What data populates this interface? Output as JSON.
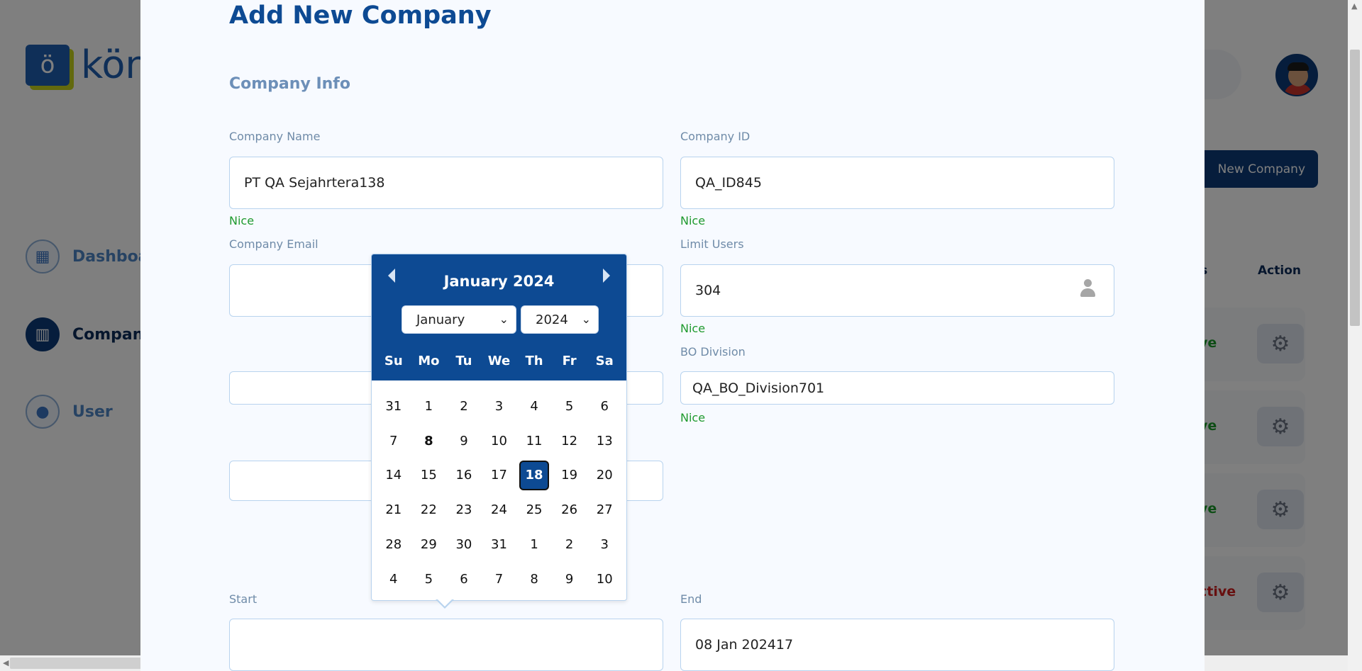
{
  "background": {
    "logo": {
      "mark": "ö",
      "text": "kön"
    },
    "sidebar": [
      {
        "label": "Dashboa",
        "icon": "dashboard-icon"
      },
      {
        "label": "Company",
        "icon": "company-icon"
      },
      {
        "label": "User",
        "icon": "user-icon"
      }
    ],
    "new_company_button": "New Company",
    "table": {
      "columns": [
        "us",
        "Action"
      ],
      "rows": [
        {
          "status": "ve",
          "status_color": "#1a9a2b"
        },
        {
          "status": "ve",
          "status_color": "#1a9a2b"
        },
        {
          "status": "ve",
          "status_color": "#1a9a2b"
        },
        {
          "status": "ctive",
          "status_color": "#cf1e1e"
        }
      ]
    }
  },
  "modal": {
    "title": "Add New Company",
    "section_title": "Company Info",
    "fields": {
      "company_name": {
        "label": "Company Name",
        "value": "PT QA Sejahrtera138",
        "hint": "Nice"
      },
      "company_id": {
        "label": "Company ID",
        "value": "QA_ID845",
        "hint": "Nice"
      },
      "company_email": {
        "label": "Company Email",
        "value": ""
      },
      "limit_users": {
        "label": "Limit Users",
        "value": "304",
        "hint": "Nice"
      },
      "bo_division": {
        "label": "BO Division",
        "value": "QA_BO_Division701",
        "hint": "Nice"
      },
      "start": {
        "label": "Start",
        "value": ""
      },
      "end": {
        "label": "End",
        "value": "08 Jan 202417"
      }
    }
  },
  "datepicker": {
    "title": "January 2024",
    "month_select": "January",
    "year_select": "2024",
    "weekdays": [
      "Su",
      "Mo",
      "Tu",
      "We",
      "Th",
      "Fr",
      "Sa"
    ],
    "weeks": [
      [
        "31",
        "1",
        "2",
        "3",
        "4",
        "5",
        "6"
      ],
      [
        "7",
        "8",
        "9",
        "10",
        "11",
        "12",
        "13"
      ],
      [
        "14",
        "15",
        "16",
        "17",
        "18",
        "19",
        "20"
      ],
      [
        "21",
        "22",
        "23",
        "24",
        "25",
        "26",
        "27"
      ],
      [
        "28",
        "29",
        "30",
        "31",
        "1",
        "2",
        "3"
      ],
      [
        "4",
        "5",
        "6",
        "7",
        "8",
        "9",
        "10"
      ]
    ],
    "today": "8",
    "selected": "18"
  },
  "colors": {
    "brand": "#0d4a93",
    "hint_green": "#1f9a2e",
    "status_red": "#cf1e1e"
  }
}
